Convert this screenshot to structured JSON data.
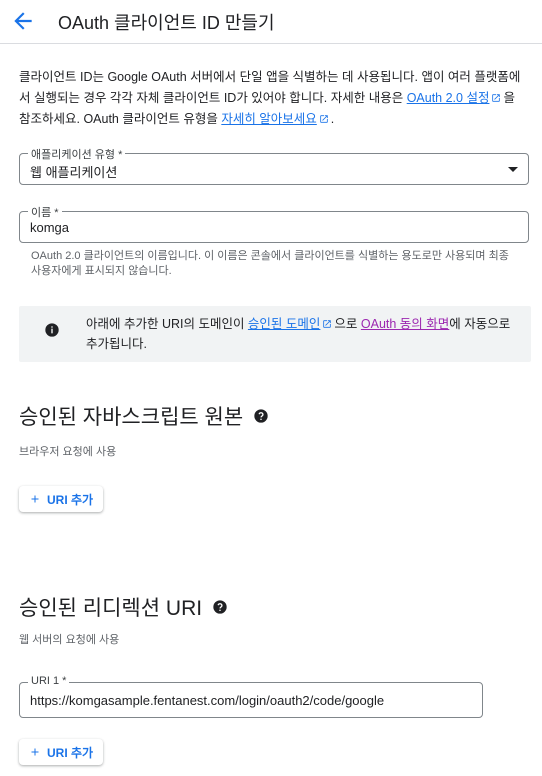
{
  "header": {
    "title": "OAuth 클라이언트 ID 만들기"
  },
  "intro": {
    "text_before": "클라이언트 ID는 Google OAuth 서버에서 단일 앱을 식별하는 데 사용됩니다. 앱이 여러 플랫폼에서 실행되는 경우 각각 자체 클라이언트 ID가 있어야 합니다. 자세한 내용은 ",
    "link1": "OAuth 2.0 설정",
    "text_mid": "을 참조하세요. OAuth 클라이언트 유형을 ",
    "link2": "자세히 알아보세요",
    "text_after": "."
  },
  "app_type": {
    "label": "애플리케이션 유형 *",
    "value": "웹 애플리케이션"
  },
  "name_field": {
    "label": "이름 *",
    "value": "komga",
    "helper": "OAuth 2.0 클라이언트의 이름입니다. 이 이름은 콘솔에서 클라이언트를 식별하는 용도로만 사용되며 최종 사용자에게 표시되지 않습니다."
  },
  "info_box": {
    "text_before": "아래에 추가한 URI의 도메인이 ",
    "link1": "승인된 도메인",
    "text_mid": "으로 ",
    "link2": "OAuth 동의 화면",
    "text_after": "에 자동으로 추가됩니다."
  },
  "origins": {
    "title": "승인된 자바스크립트 원본",
    "subtitle": "브라우저 요청에 사용",
    "add_button": "URI 추가"
  },
  "redirects": {
    "title": "승인된 리디렉션 URI",
    "subtitle": "웹 서버의 요청에 사용",
    "uri1_label": "URI 1 *",
    "uri1_value": "https://komgasample.fentanest.com/login/oauth2/code/google",
    "add_button": "URI 추가"
  },
  "colors": {
    "link": "#1a73e8",
    "visited_link": "#9c27b0",
    "info_bg": "#f1f3f4"
  }
}
